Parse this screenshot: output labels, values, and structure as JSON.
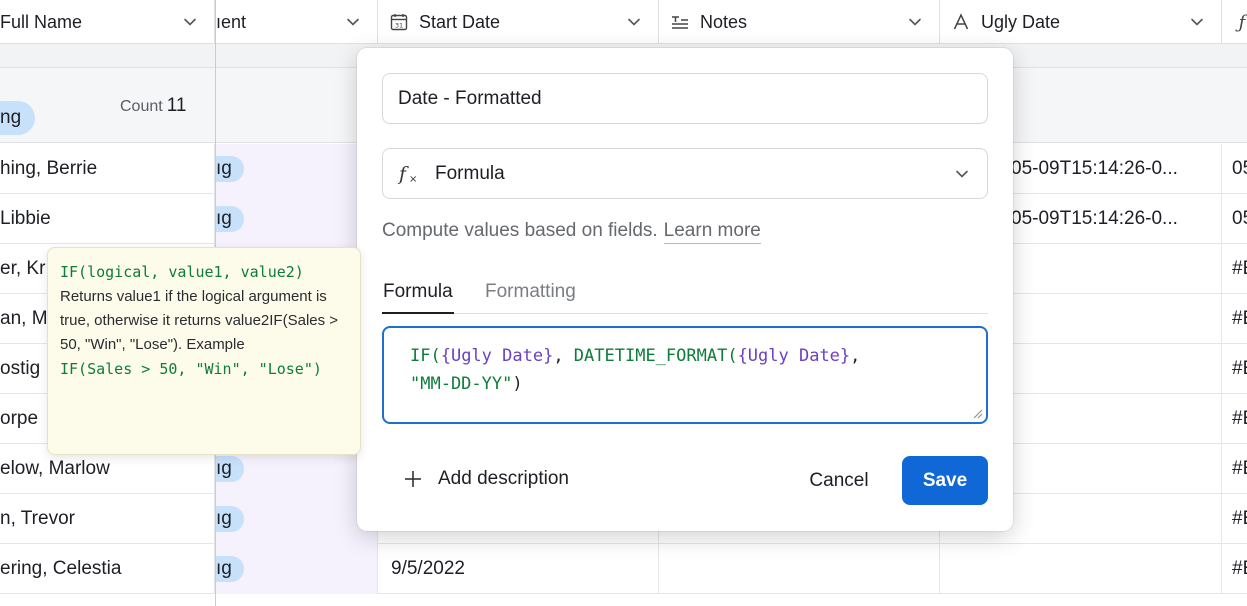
{
  "columns": {
    "full_name": "Full Name",
    "status_partial": "ıent",
    "start_date": "Start Date",
    "notes": "Notes",
    "ugly_date": "Ugly Date"
  },
  "group": {
    "pill_label": "ng",
    "count_label": "Count",
    "count_value": "11"
  },
  "rows": [
    {
      "name": "hing, Berrie",
      "status": "ıg",
      "start": "",
      "ugly": "05-09T15:14:26-0...",
      "fx": "05"
    },
    {
      "name": "Libbie",
      "status": "ıg",
      "start": "",
      "ugly": "05-09T15:14:26-0...",
      "fx": "05"
    },
    {
      "name": "er, Kr",
      "status": "",
      "start": "",
      "ugly": "",
      "fx": "#E"
    },
    {
      "name": "an, M",
      "status": "",
      "start": "",
      "ugly": "",
      "fx": "#E"
    },
    {
      "name": "ostig",
      "status": "",
      "start": "",
      "ugly": "",
      "fx": "#E"
    },
    {
      "name": "orpe",
      "status": "",
      "start": "",
      "ugly": "",
      "fx": "#E"
    },
    {
      "name": "elow, Marlow",
      "status": "ıg",
      "start": "",
      "ugly": "",
      "fx": "#E"
    },
    {
      "name": "n, Trevor",
      "status": "ıg",
      "start": "",
      "ugly": "",
      "fx": "#E"
    },
    {
      "name": "ering, Celestia",
      "status": "ıg",
      "start": "9/5/2022",
      "ugly": "",
      "fx": "#E"
    }
  ],
  "dialog": {
    "field_name_value": "Date - Formatted",
    "field_type": "Formula",
    "help_text": "Compute values based on fields.",
    "learn_more": "Learn more",
    "tab_formula": "Formula",
    "tab_formatting": "Formatting",
    "formula": {
      "t1": "IF(",
      "t2": "{Ugly Date}",
      "t3": ", ",
      "t4": "DATETIME_FORMAT(",
      "t5": "{Ugly Date}",
      "t6": ",",
      "t7": "\"MM-DD-YY\"",
      "t8": ")"
    },
    "add_description": "Add description",
    "cancel": "Cancel",
    "save": "Save"
  },
  "tooltip": {
    "signature": "IF(logical, value1, value2)",
    "description": "Returns value1 if the logical argument is true, otherwise it returns value2IF(Sales > 50, \"Win\", \"Lose\"). Example",
    "example": "IF(Sales > 50, \"Win\", \"Lose\")"
  },
  "icons": {
    "calendar": "calendar-icon",
    "notes": "long-text-icon",
    "ugly_date": "single-line-text-icon",
    "formula": "formula-icon",
    "chevron": "chevron-down-icon",
    "plus": "plus-icon"
  },
  "colors": {
    "accent": "#0f68d6",
    "group_pill": "#c8e1fb",
    "tooltip_bg": "#fdfbe9",
    "code_function": "#0e7c3a",
    "code_field_ref": "#6b3fc7"
  }
}
